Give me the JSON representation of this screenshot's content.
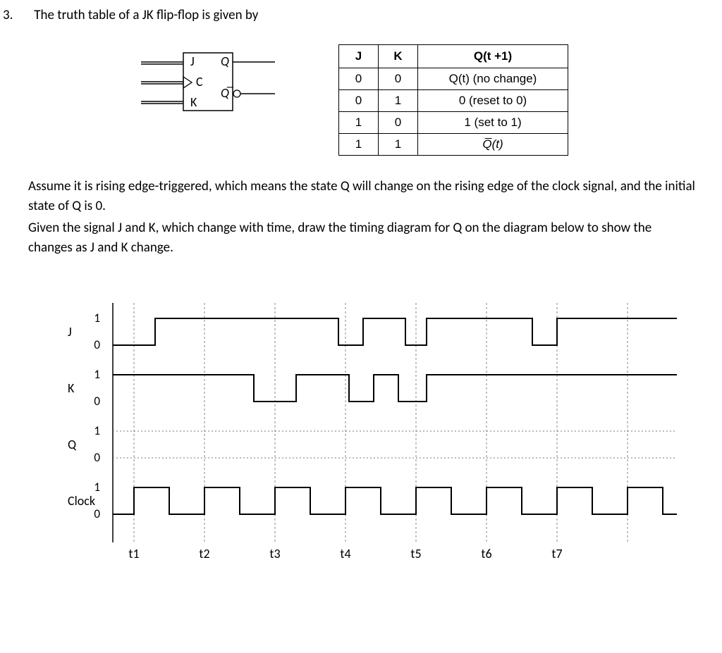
{
  "question": {
    "number": "3.",
    "prompt": "The truth table of a JK flip-flop is given by"
  },
  "flipflop": {
    "labels": {
      "J": "J",
      "K": "K",
      "C": "C",
      "Q": "Q",
      "Qbar": "Q̅"
    }
  },
  "truth_table": {
    "headers": [
      "J",
      "K",
      "Q(t +1)"
    ],
    "rows": [
      {
        "J": "0",
        "K": "0",
        "Q": "Q(t) (no change)"
      },
      {
        "J": "0",
        "K": "1",
        "Q": "0 (reset to 0)"
      },
      {
        "J": "1",
        "K": "0",
        "Q": "1 (set to 1)"
      },
      {
        "J": "1",
        "K": "1",
        "Q": "Q̅(t)"
      }
    ]
  },
  "body": {
    "p1": "Assume it is rising edge-triggered, which means the state Q will change on the rising edge of the clock signal, and the initial state of Q is 0.",
    "p2": "Given the signal J and K, which change with time, draw the timing diagram for Q on the diagram below to show the changes as J and K change."
  },
  "timing": {
    "signals": [
      "J",
      "K",
      "Q",
      "Clock"
    ],
    "levels": [
      "1",
      "0"
    ],
    "ticks": [
      "t1",
      "t2",
      "t3",
      "t4",
      "t5",
      "t6",
      "t7"
    ]
  },
  "chart_data": {
    "type": "timing-diagram",
    "x_unit": "clock-period-fraction",
    "period": 100,
    "tick_positions": [
      30,
      130,
      230,
      330,
      430,
      530,
      630
    ],
    "rising_edges": [
      30,
      130,
      230,
      330,
      430,
      530,
      630,
      730
    ],
    "signals": [
      {
        "name": "J",
        "edges": [
          [
            0,
            0
          ],
          [
            60,
            0
          ],
          [
            60,
            1
          ],
          [
            320,
            1
          ],
          [
            320,
            0
          ],
          [
            355,
            0
          ],
          [
            355,
            1
          ],
          [
            415,
            1
          ],
          [
            415,
            0
          ],
          [
            445,
            0
          ],
          [
            445,
            1
          ],
          [
            595,
            1
          ],
          [
            595,
            0
          ],
          [
            630,
            0
          ],
          [
            630,
            1
          ],
          [
            800,
            1
          ]
        ]
      },
      {
        "name": "K",
        "edges": [
          [
            0,
            1
          ],
          [
            200,
            1
          ],
          [
            200,
            0
          ],
          [
            260,
            0
          ],
          [
            260,
            1
          ],
          [
            335,
            1
          ],
          [
            335,
            0
          ],
          [
            370,
            0
          ],
          [
            370,
            1
          ],
          [
            405,
            1
          ],
          [
            405,
            0
          ],
          [
            445,
            0
          ],
          [
            445,
            1
          ],
          [
            800,
            1
          ]
        ]
      },
      {
        "name": "Q",
        "initial": 0,
        "note": "to be drawn by student",
        "edges": []
      },
      {
        "name": "Clock",
        "edges": [
          [
            0,
            0
          ],
          [
            30,
            0
          ],
          [
            30,
            1
          ],
          [
            80,
            1
          ],
          [
            80,
            0
          ],
          [
            130,
            0
          ],
          [
            130,
            1
          ],
          [
            180,
            1
          ],
          [
            180,
            0
          ],
          [
            230,
            0
          ],
          [
            230,
            1
          ],
          [
            280,
            1
          ],
          [
            280,
            0
          ],
          [
            330,
            0
          ],
          [
            330,
            1
          ],
          [
            380,
            1
          ],
          [
            380,
            0
          ],
          [
            430,
            0
          ],
          [
            430,
            1
          ],
          [
            480,
            1
          ],
          [
            480,
            0
          ],
          [
            530,
            0
          ],
          [
            530,
            1
          ],
          [
            580,
            1
          ],
          [
            580,
            0
          ],
          [
            630,
            0
          ],
          [
            630,
            1
          ],
          [
            680,
            1
          ],
          [
            680,
            0
          ],
          [
            730,
            0
          ],
          [
            730,
            1
          ],
          [
            780,
            1
          ],
          [
            780,
            0
          ],
          [
            800,
            0
          ]
        ]
      }
    ]
  }
}
